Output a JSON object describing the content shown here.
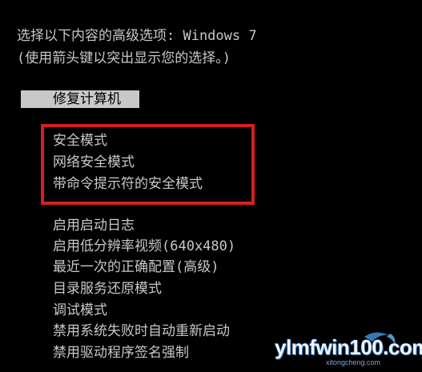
{
  "header": {
    "line1": "选择以下内容的高级选项: Windows 7",
    "line2": "(使用箭头键以突出显示您的选择。)"
  },
  "selected_option": "修复计算机",
  "options": [
    "安全模式",
    "网络安全模式",
    "带命令提示符的安全模式",
    "启用启动日志",
    "启用低分辨率视频(640x480)",
    "最近一次的正确配置(高级)",
    "目录服务还原模式",
    "调试模式",
    "禁用系统失败时自动重新启动",
    "禁用驱动程序签名强制"
  ],
  "watermark": {
    "text": "ylmfwin100.com",
    "sub": "xitongcheng.com"
  },
  "colors": {
    "background": "#000000",
    "text": "#c8c8c8",
    "highlight_border": "#d81e1e"
  }
}
